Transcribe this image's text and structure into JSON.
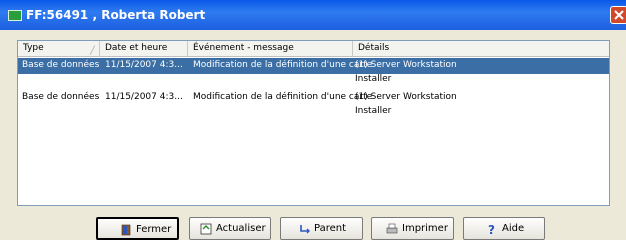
{
  "window": {
    "title": "FF:56491 , Roberta Robert"
  },
  "listview": {
    "columns": [
      "Type",
      "Date et heure",
      "Événement - message",
      "Détails"
    ],
    "rows": [
      {
        "type": "Base de données",
        "datetime": "11/15/2007 4:3...",
        "event": "Modification de la définition d'une carte",
        "details_line1": "(1) Server Workstation",
        "details_line2": "Installer",
        "selected": true
      },
      {
        "type": "Base de données",
        "datetime": "11/15/2007 4:3...",
        "event": "Modification de la définition d'une carte",
        "details_line1": "(1) Server Workstation",
        "details_line2": "Installer",
        "selected": false
      }
    ]
  },
  "buttons": {
    "close": "Fermer",
    "refresh": "Actualiser",
    "parent": "Parent",
    "print": "Imprimer",
    "help": "Aide"
  },
  "icons": [
    "app-icon",
    "close-icon",
    "door-icon",
    "refresh-icon",
    "parent-arrow-icon",
    "printer-icon",
    "help-icon"
  ],
  "colors": {
    "titlebar": "#0a58e8",
    "selection": "#3a6ea5",
    "close": "#d2482a"
  }
}
